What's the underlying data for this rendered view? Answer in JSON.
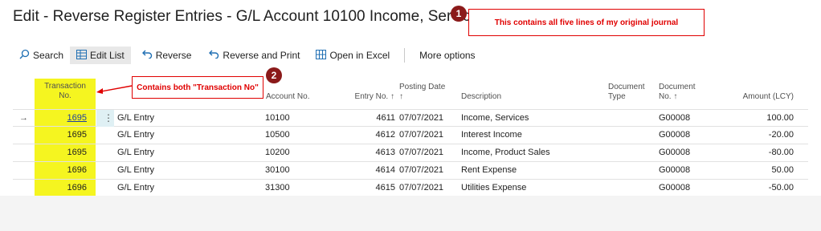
{
  "page": {
    "title": "Edit - Reverse Register Entries - G/L Account 10100 Income, Services"
  },
  "callouts": [
    {
      "number": "1",
      "text": "This contains all five lines of my original journal"
    },
    {
      "number": "2",
      "text": "Contains both \"Transaction No\""
    }
  ],
  "toolbar": {
    "search": "Search",
    "edit_list": "Edit List",
    "reverse": "Reverse",
    "reverse_print": "Reverse and Print",
    "open_excel": "Open in Excel",
    "more_options": "More options"
  },
  "table": {
    "headers": {
      "transaction_no": "Transaction No.",
      "account_no": "Account No.",
      "entry_no": "Entry No. ↑",
      "posting_date": "Posting Date ↑",
      "description": "Description",
      "document_type": "Document Type",
      "document_no": "Document No. ↑",
      "amount": "Amount (LCY)"
    },
    "rows": [
      {
        "transaction_no": "1695",
        "source": "G/L Entry",
        "account_no": "10100",
        "entry_no": "4611",
        "posting_date": "07/07/2021",
        "description": "Income, Services",
        "document_type": "",
        "document_no": "G00008",
        "amount": "100.00"
      },
      {
        "transaction_no": "1695",
        "source": "G/L Entry",
        "account_no": "10500",
        "entry_no": "4612",
        "posting_date": "07/07/2021",
        "description": "Interest Income",
        "document_type": "",
        "document_no": "G00008",
        "amount": "-20.00"
      },
      {
        "transaction_no": "1695",
        "source": "G/L Entry",
        "account_no": "10200",
        "entry_no": "4613",
        "posting_date": "07/07/2021",
        "description": "Income, Product Sales",
        "document_type": "",
        "document_no": "G00008",
        "amount": "-80.00"
      },
      {
        "transaction_no": "1696",
        "source": "G/L Entry",
        "account_no": "30100",
        "entry_no": "4614",
        "posting_date": "07/07/2021",
        "description": "Rent Expense",
        "document_type": "",
        "document_no": "G00008",
        "amount": "50.00"
      },
      {
        "transaction_no": "1696",
        "source": "G/L Entry",
        "account_no": "31300",
        "entry_no": "4615",
        "posting_date": "07/07/2021",
        "description": "Utilities Expense",
        "document_type": "",
        "document_no": "G00008",
        "amount": "-50.00"
      }
    ]
  },
  "colors": {
    "highlight": "#f5f520",
    "callout_red": "#e00000",
    "badge": "#8b1a1a",
    "link": "#1f3f9f"
  }
}
